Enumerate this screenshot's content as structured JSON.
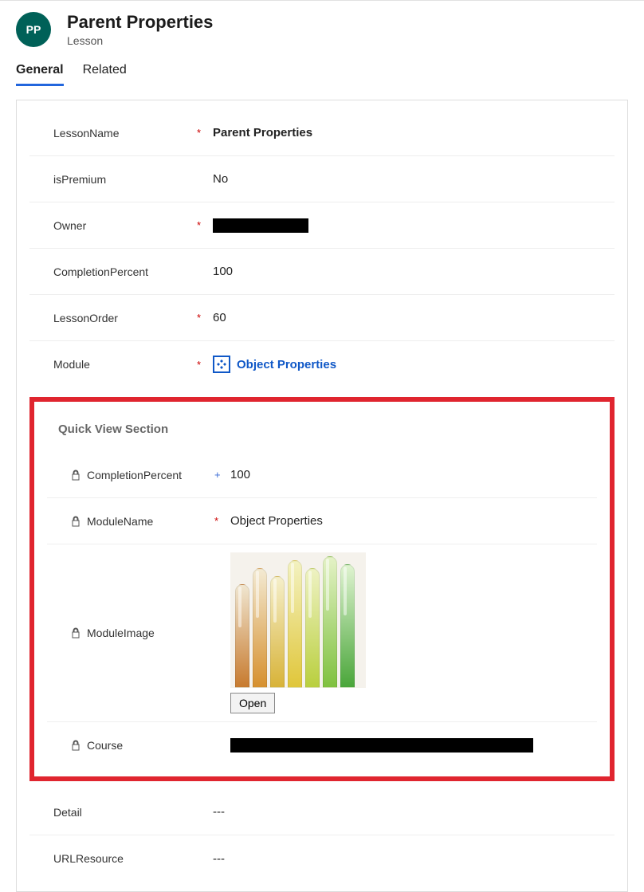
{
  "header": {
    "avatar_initials": "PP",
    "title": "Parent Properties",
    "subtitle": "Lesson"
  },
  "tabs": {
    "general": "General",
    "related": "Related"
  },
  "fields": {
    "lessonName": {
      "label": "LessonName",
      "value": "Parent Properties",
      "required": "*"
    },
    "isPremium": {
      "label": "isPremium",
      "value": "No",
      "required": ""
    },
    "owner": {
      "label": "Owner",
      "required": "*"
    },
    "completionPercent": {
      "label": "CompletionPercent",
      "value": "100",
      "required": ""
    },
    "lessonOrder": {
      "label": "LessonOrder",
      "value": "60",
      "required": "*"
    },
    "module": {
      "label": "Module",
      "value": "Object Properties",
      "required": "*"
    },
    "detail": {
      "label": "Detail",
      "value": "---",
      "required": ""
    },
    "urlResource": {
      "label": "URLResource",
      "value": "---",
      "required": ""
    }
  },
  "quickView": {
    "title": "Quick View Section",
    "completionPercent": {
      "label": "CompletionPercent",
      "value": "100",
      "mark": "+"
    },
    "moduleName": {
      "label": "ModuleName",
      "value": "Object Properties",
      "mark": "*"
    },
    "moduleImage": {
      "label": "ModuleImage",
      "open": "Open"
    },
    "course": {
      "label": "Course"
    }
  }
}
